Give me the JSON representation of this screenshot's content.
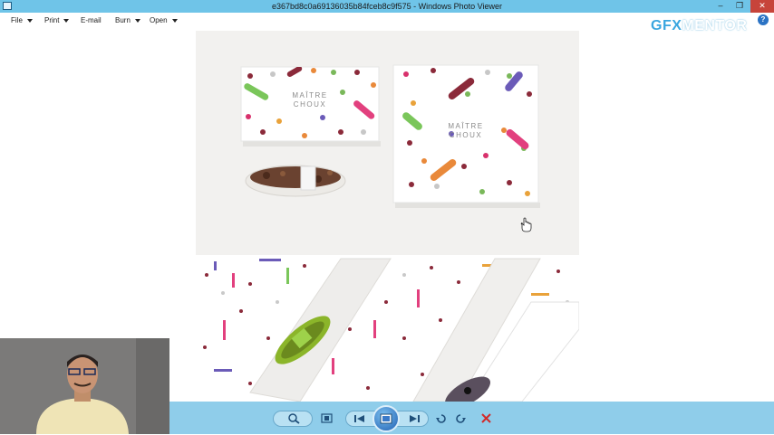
{
  "window": {
    "title": "e367bd8c0a69136035b84fceb8c9f575 - Windows Photo Viewer",
    "minimize_glyph": "–",
    "restore_glyph": "❐",
    "close_glyph": "✕"
  },
  "menu": {
    "items": [
      {
        "label": "File",
        "has_dropdown": true
      },
      {
        "label": "Print",
        "has_dropdown": true
      },
      {
        "label": "E-mail",
        "has_dropdown": false
      },
      {
        "label": "Burn",
        "has_dropdown": true
      },
      {
        "label": "Open",
        "has_dropdown": true
      }
    ],
    "help_glyph": "?"
  },
  "watermark": {
    "part1": "GFX",
    "part2": "MENTOR"
  },
  "photo": {
    "box_brand_line1": "MAÎTRE",
    "box_brand_line2": "CHOUX"
  },
  "toolbar": {
    "icons": [
      "zoom-icon",
      "actual-size-icon",
      "previous-icon",
      "slideshow-icon",
      "next-icon",
      "rotate-ccw-icon",
      "rotate-cw-icon",
      "delete-icon"
    ]
  },
  "colors": {
    "titlebar": "#6fc4e8",
    "toolbar": "#8fcdea",
    "delete": "#d22a2a",
    "accent": "#2b73c4"
  }
}
